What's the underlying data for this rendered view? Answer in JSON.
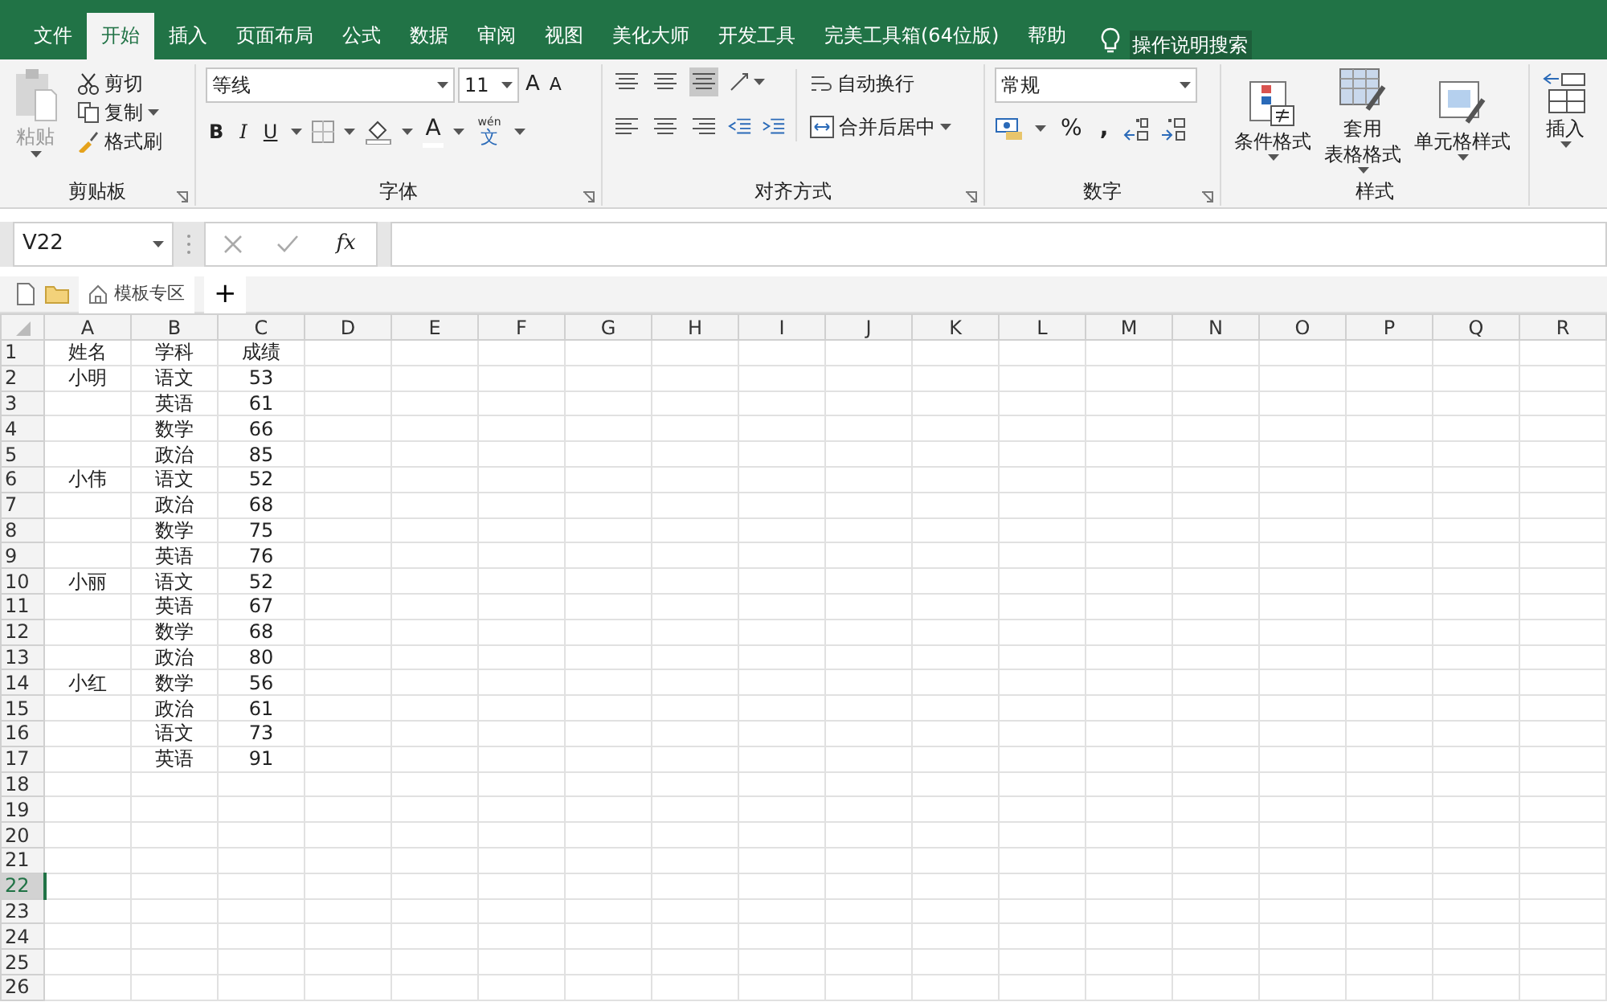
{
  "ribbon_tabs": [
    {
      "label": "文件",
      "selected": false
    },
    {
      "label": "开始",
      "selected": true
    },
    {
      "label": "插入",
      "selected": false
    },
    {
      "label": "页面布局",
      "selected": false
    },
    {
      "label": "公式",
      "selected": false
    },
    {
      "label": "数据",
      "selected": false
    },
    {
      "label": "审阅",
      "selected": false
    },
    {
      "label": "视图",
      "selected": false
    },
    {
      "label": "美化大师",
      "selected": false
    },
    {
      "label": "开发工具",
      "selected": false
    },
    {
      "label": "完美工具箱(64位版)",
      "selected": false
    },
    {
      "label": "帮助",
      "selected": false
    }
  ],
  "tell_me": "操作说明搜索",
  "clipboard": {
    "paste": "粘贴",
    "cut": "剪切",
    "copy": "复制",
    "format_painter": "格式刷",
    "title": "剪贴板"
  },
  "font": {
    "name": "等线",
    "size": "11",
    "grow": "A",
    "shrink": "A",
    "bold": "B",
    "italic": "I",
    "underline": "U",
    "font_color": "A",
    "phonetic_top": "wén",
    "phonetic": "文",
    "title": "字体"
  },
  "alignment": {
    "wrap": "自动换行",
    "merge": "合并后居中",
    "title": "对齐方式"
  },
  "number": {
    "format": "常规",
    "percent": "%",
    "comma": ",",
    "title": "数字"
  },
  "styles": {
    "conditional": "条件格式",
    "table_1": "套用",
    "table_2": "表格格式",
    "cell_styles": "单元格样式",
    "title": "样式"
  },
  "cells": {
    "insert": "插入"
  },
  "formula_bar": {
    "name_box": "V22",
    "fx": "fx"
  },
  "template_tab": "模板专区",
  "add_tab": "+",
  "columns": [
    "A",
    "B",
    "C",
    "D",
    "E",
    "F",
    "G",
    "H",
    "I",
    "J",
    "K",
    "L",
    "M",
    "N",
    "O",
    "P",
    "Q",
    "R"
  ],
  "rows": [
    {
      "number": "1",
      "selected": false,
      "cells": [
        "姓名",
        "学科",
        "成绩"
      ]
    },
    {
      "number": "2",
      "selected": false,
      "cells": [
        "小明",
        "语文",
        "53"
      ]
    },
    {
      "number": "3",
      "selected": false,
      "cells": [
        "",
        "英语",
        "61"
      ]
    },
    {
      "number": "4",
      "selected": false,
      "cells": [
        "",
        "数学",
        "66"
      ]
    },
    {
      "number": "5",
      "selected": false,
      "cells": [
        "",
        "政治",
        "85"
      ]
    },
    {
      "number": "6",
      "selected": false,
      "cells": [
        "小伟",
        "语文",
        "52"
      ]
    },
    {
      "number": "7",
      "selected": false,
      "cells": [
        "",
        "政治",
        "68"
      ]
    },
    {
      "number": "8",
      "selected": false,
      "cells": [
        "",
        "数学",
        "75"
      ]
    },
    {
      "number": "9",
      "selected": false,
      "cells": [
        "",
        "英语",
        "76"
      ]
    },
    {
      "number": "10",
      "selected": false,
      "cells": [
        "小丽",
        "语文",
        "52"
      ]
    },
    {
      "number": "11",
      "selected": false,
      "cells": [
        "",
        "英语",
        "67"
      ]
    },
    {
      "number": "12",
      "selected": false,
      "cells": [
        "",
        "数学",
        "68"
      ]
    },
    {
      "number": "13",
      "selected": false,
      "cells": [
        "",
        "政治",
        "80"
      ]
    },
    {
      "number": "14",
      "selected": false,
      "cells": [
        "小红",
        "数学",
        "56"
      ]
    },
    {
      "number": "15",
      "selected": false,
      "cells": [
        "",
        "政治",
        "61"
      ]
    },
    {
      "number": "16",
      "selected": false,
      "cells": [
        "",
        "语文",
        "73"
      ]
    },
    {
      "number": "17",
      "selected": false,
      "cells": [
        "",
        "英语",
        "91"
      ]
    },
    {
      "number": "18",
      "selected": false,
      "cells": []
    },
    {
      "number": "19",
      "selected": false,
      "cells": []
    },
    {
      "number": "20",
      "selected": false,
      "cells": []
    },
    {
      "number": "21",
      "selected": false,
      "cells": []
    },
    {
      "number": "22",
      "selected": true,
      "cells": []
    },
    {
      "number": "23",
      "selected": false,
      "cells": []
    },
    {
      "number": "24",
      "selected": false,
      "cells": []
    },
    {
      "number": "25",
      "selected": false,
      "cells": []
    },
    {
      "number": "26",
      "selected": false,
      "cells": []
    }
  ]
}
